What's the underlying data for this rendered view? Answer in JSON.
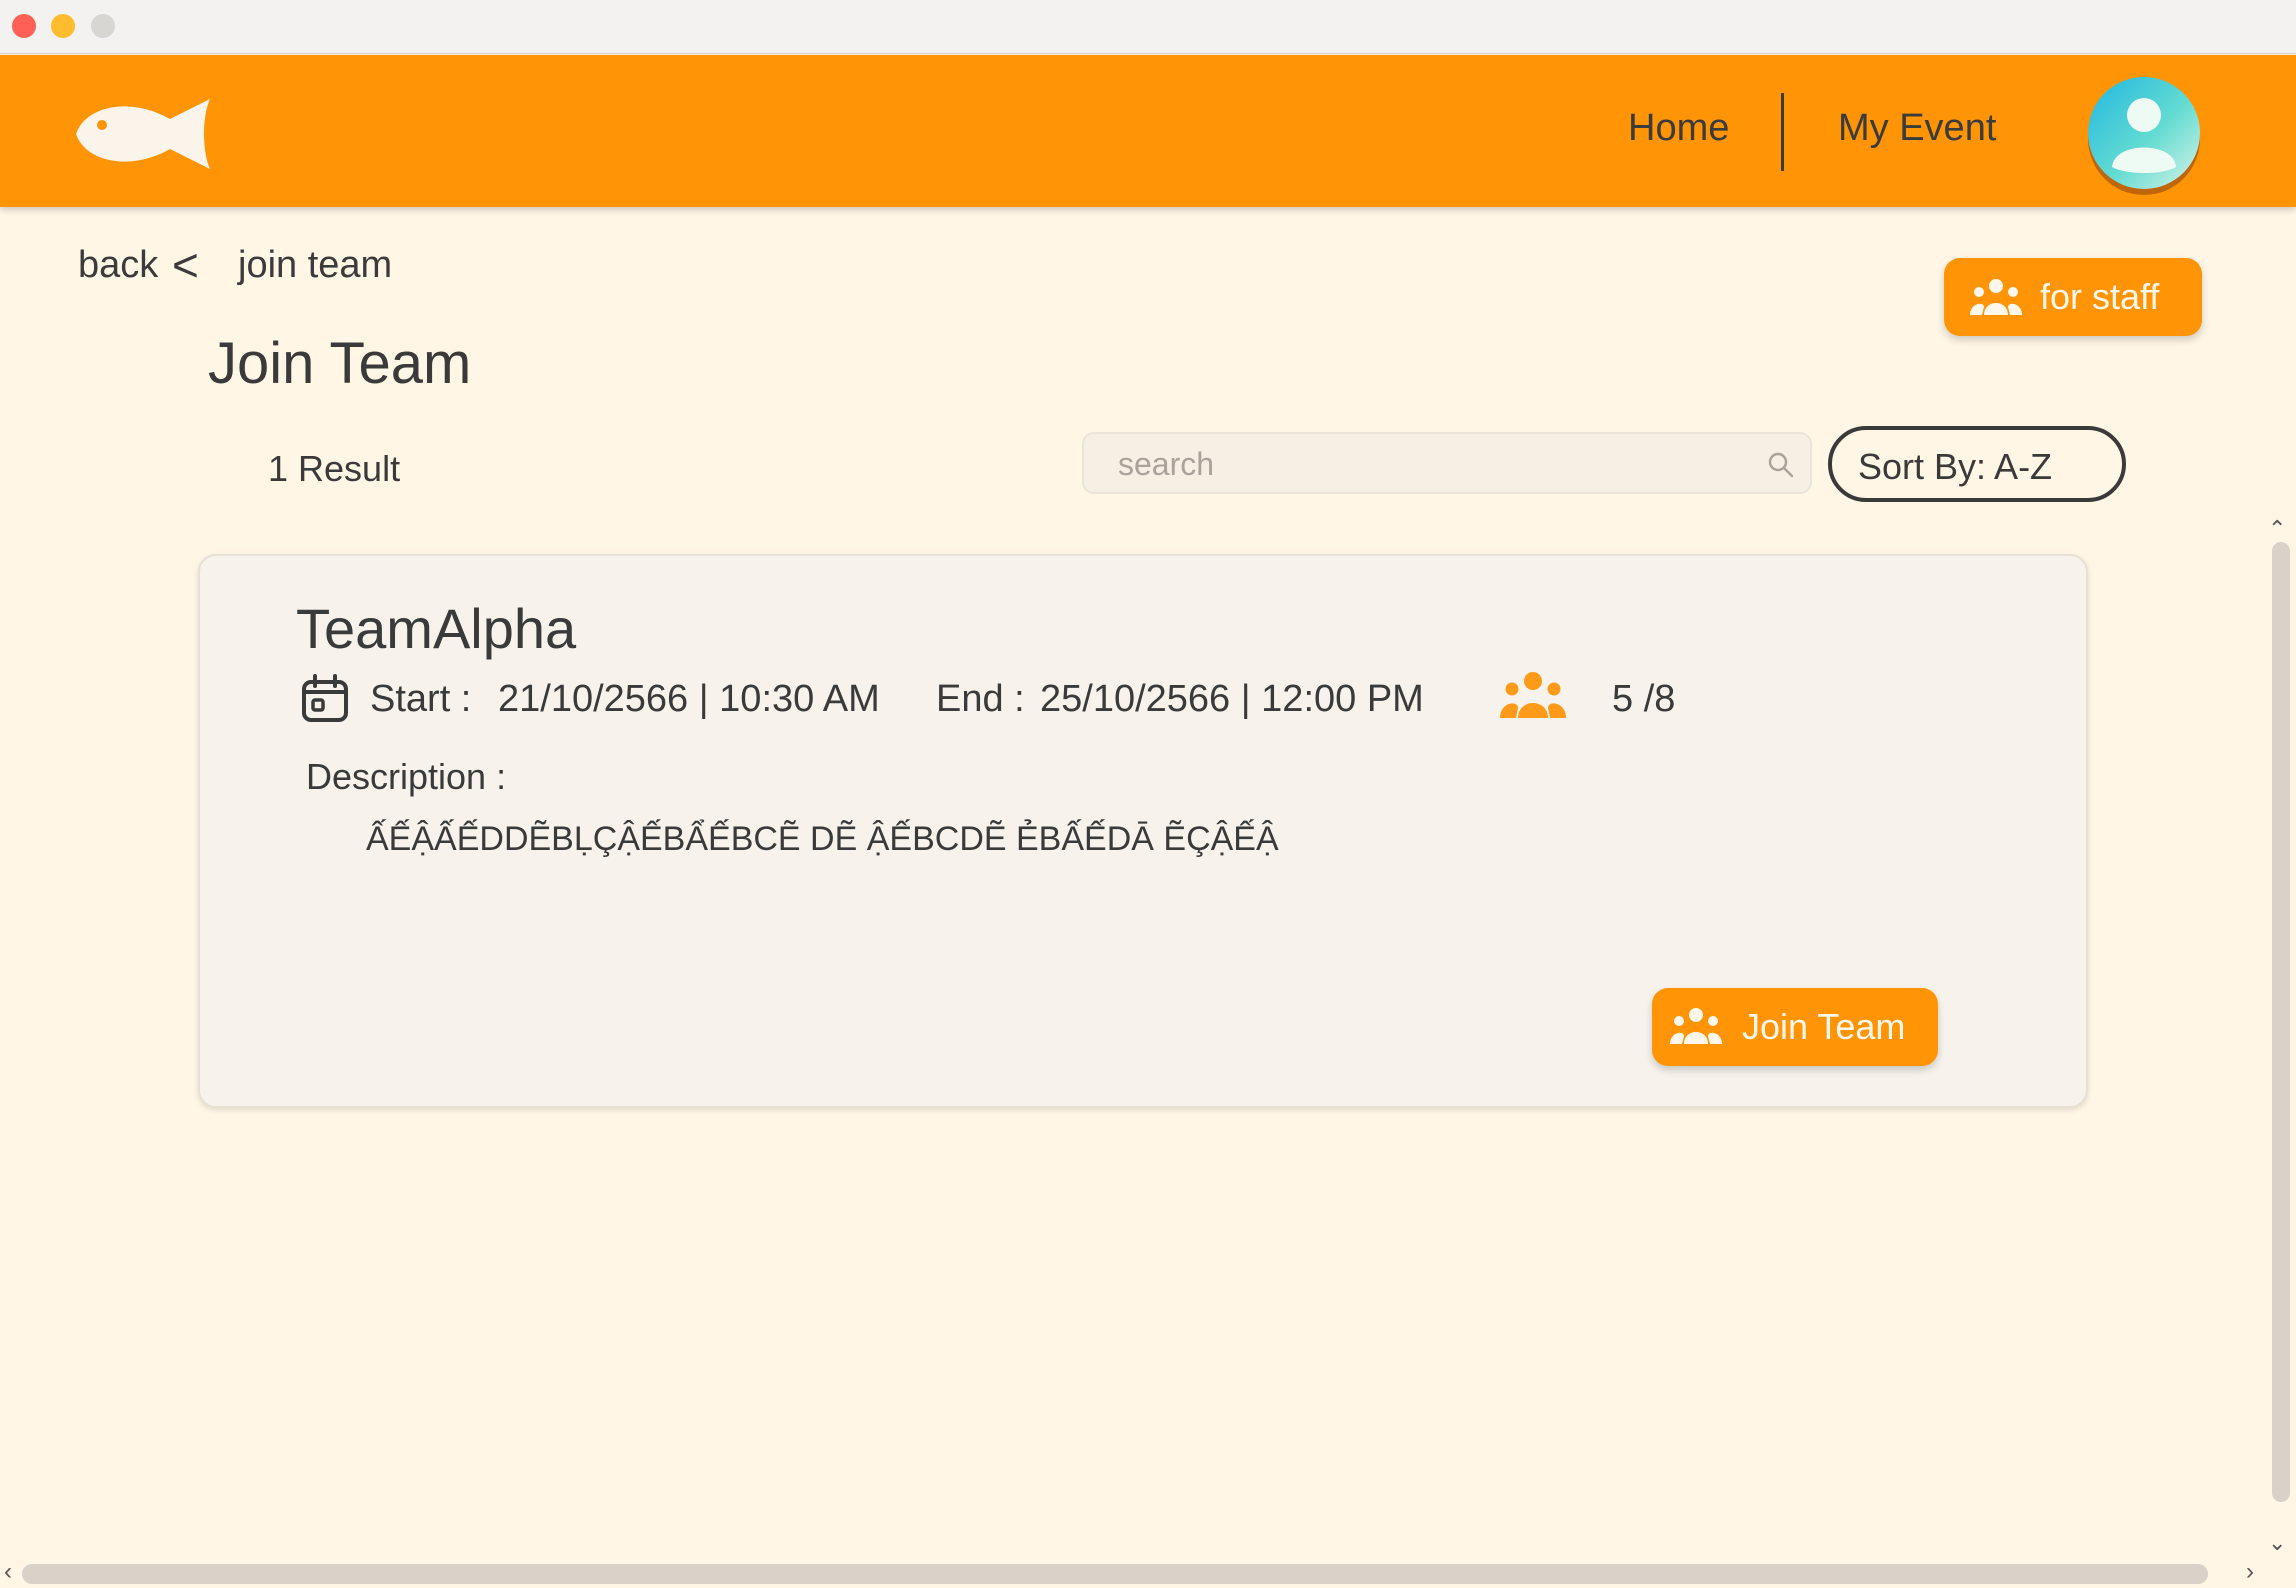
{
  "header": {
    "nav": [
      {
        "label": "Home"
      },
      {
        "label": "My Event"
      }
    ]
  },
  "breadcrumb": {
    "back": "back",
    "separator": "<",
    "current": "join team"
  },
  "staff_button": {
    "label": "for staff"
  },
  "page": {
    "title": "Join Team",
    "result_count": "1 Result"
  },
  "search": {
    "placeholder": "search",
    "value": ""
  },
  "sort": {
    "label": "Sort By: A-Z"
  },
  "teams": [
    {
      "name": "TeamAlpha",
      "start_label": "Start :",
      "start_value": "21/10/2566 | 10:30 AM",
      "end_label": "End :",
      "end_value": "25/10/2566 | 12:00 PM",
      "members": "5 /8",
      "description_label": "Description :",
      "description": "ẤẾẬẤẾDDẼBḶÇẬẾBẨẾBCẼ DẼ ẬẾBCDẼ ẺBẤẾDĀ ẼÇẬẾẬ",
      "join_label": "Join Team"
    }
  ],
  "colors": {
    "header": "#fe9406",
    "background": "#fff6e6",
    "accent": "#fe9406"
  }
}
